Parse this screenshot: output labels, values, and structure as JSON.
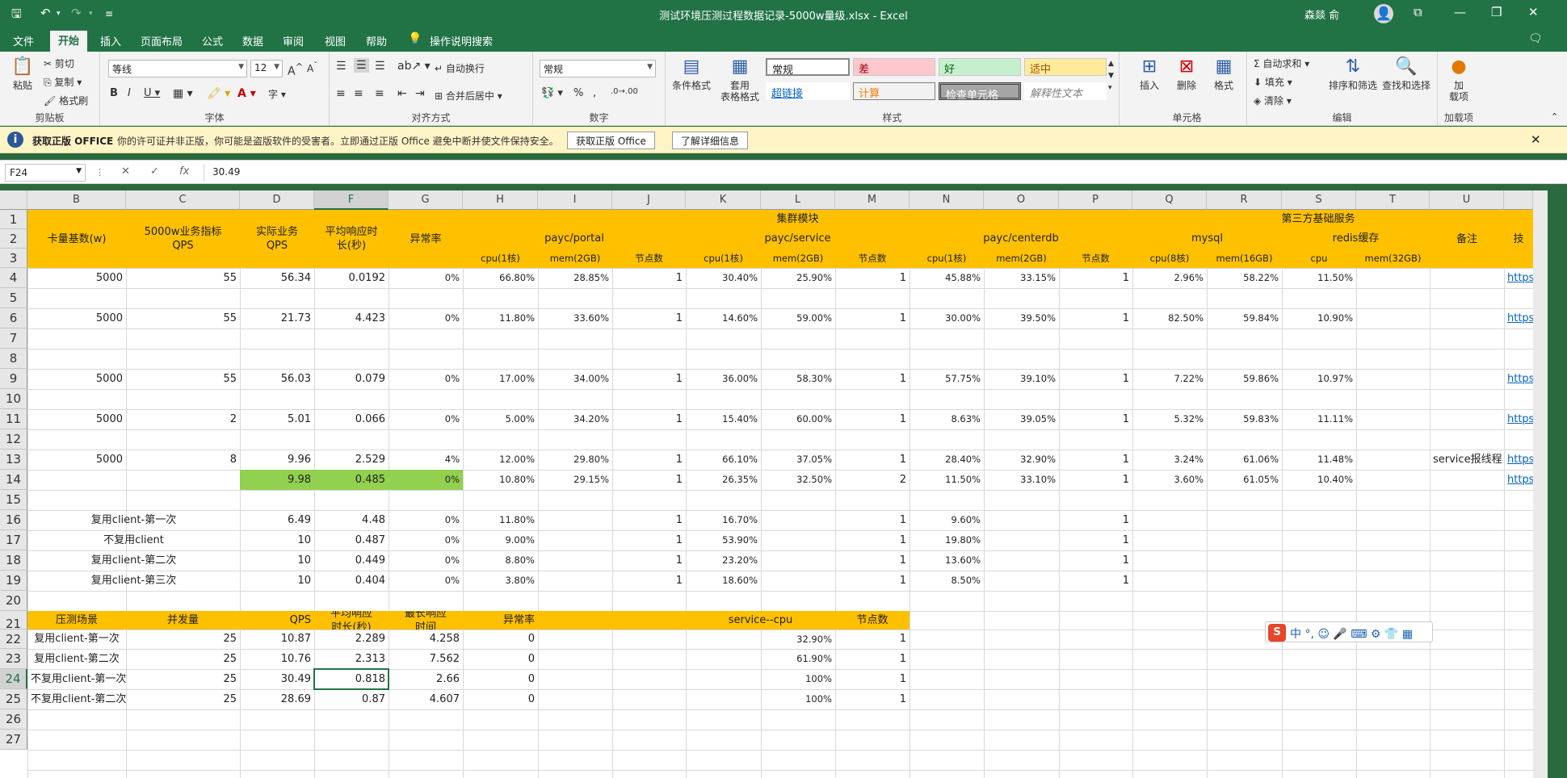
{
  "window": {
    "title": "测试环境压测过程数据记录-5000w量级.xlsx  -  Excel",
    "user": "森燚 俞"
  },
  "menu": [
    "文件",
    "开始",
    "插入",
    "页面布局",
    "公式",
    "数据",
    "审阅",
    "视图",
    "帮助",
    "操作说明搜索"
  ],
  "ribbon": {
    "clipboard": {
      "paste": "粘贴",
      "cut": "剪切",
      "copy": "复制",
      "format_painter": "格式刷",
      "label": "剪贴板"
    },
    "font": {
      "name": "等线",
      "size": "12",
      "label": "字体"
    },
    "alignment": {
      "wrap": "自动换行",
      "merge": "合并后居中",
      "label": "对齐方式"
    },
    "number": {
      "format": "常规",
      "label": "数字"
    },
    "styles": {
      "cond": "条件格式",
      "table": "套用\n表格格式",
      "s1": "常规",
      "s2": "差",
      "s3": "好",
      "s4": "适中",
      "s5": "超链接",
      "s6": "计算",
      "s7": "检查单元格",
      "s8": "解释性文本",
      "label": "样式"
    },
    "cells": {
      "insert": "插入",
      "delete": "删除",
      "format": "格式",
      "label": "单元格"
    },
    "editing": {
      "autosum": "自动求和",
      "fill": "填充",
      "clear": "清除",
      "sort": "排序和筛选",
      "find": "查找和选择",
      "label": "编辑"
    },
    "addins": {
      "add": "加\n载项",
      "label": "加载项"
    }
  },
  "message": {
    "bold": "获取正版 OFFICE",
    "text": "你的许可证并非正版，你可能是盗版软件的受害者。立即通过正版 Office 避免中断并使文件保持安全。",
    "btn1": "获取正版 Office",
    "btn2": "了解详细信息"
  },
  "formula_bar": {
    "name_box": "F24",
    "value": "30.49"
  },
  "columns": [
    "B",
    "C",
    "D",
    "F",
    "G",
    "H",
    "I",
    "J",
    "K",
    "L",
    "M",
    "N",
    "O",
    "P",
    "Q",
    "R",
    "S",
    "T",
    "U",
    ""
  ],
  "rows": [
    "1",
    "2",
    "3",
    "4",
    "5",
    "6",
    "7",
    "8",
    "9",
    "10",
    "11",
    "12",
    "13",
    "14",
    "15",
    "16",
    "17",
    "18",
    "19",
    "20",
    "21",
    "22",
    "23",
    "24",
    "25",
    "26",
    "27"
  ],
  "header": {
    "b": "卡量基数(w)",
    "c": "5000w业务指标\nQPS",
    "d": "实际业务\nQPS",
    "f": "平均响应时\n长(秒)",
    "g": "异常率",
    "cluster": "集群模块",
    "third": "第三方基础服务",
    "portal": "payc/portal",
    "service": "payc/service",
    "centerdb": "payc/centerdb",
    "mysql": "mysql",
    "redis": "redis缓存",
    "note": "备注",
    "v": "技",
    "cpu1": "cpu(1核)",
    "mem2": "mem(2GB)",
    "nodes": "节点数",
    "cpu8": "cpu(8核)",
    "mem16": "mem(16GB)",
    "cpu": "cpu",
    "mem32": "mem(32GB)"
  },
  "table1": [
    {
      "row": 4,
      "B": "5000",
      "C": "55",
      "D": "56.34",
      "F": "0.0192",
      "G": "0%",
      "H": "66.80%",
      "I": "28.85%",
      "J": "1",
      "K": "30.40%",
      "L": "25.90%",
      "M": "1",
      "N": "45.88%",
      "O": "33.15%",
      "P": "1",
      "Q": "2.96%",
      "R": "58.22%",
      "S": "11.50%",
      "U": "",
      "V": "https"
    },
    {
      "row": 6,
      "B": "5000",
      "C": "55",
      "D": "21.73",
      "F": "4.423",
      "G": "0%",
      "H": "11.80%",
      "I": "33.60%",
      "J": "1",
      "K": "14.60%",
      "L": "59.00%",
      "M": "1",
      "N": "30.00%",
      "O": "39.50%",
      "P": "1",
      "Q": "82.50%",
      "R": "59.84%",
      "S": "10.90%",
      "U": "",
      "V": "https"
    },
    {
      "row": 9,
      "B": "5000",
      "C": "55",
      "D": "56.03",
      "F": "0.079",
      "G": "0%",
      "H": "17.00%",
      "I": "34.00%",
      "J": "1",
      "K": "36.00%",
      "L": "58.30%",
      "M": "1",
      "N": "57.75%",
      "O": "39.10%",
      "P": "1",
      "Q": "7.22%",
      "R": "59.86%",
      "S": "10.97%",
      "U": "",
      "V": "https"
    },
    {
      "row": 11,
      "B": "5000",
      "C": "2",
      "D": "5.01",
      "F": "0.066",
      "G": "0%",
      "H": "5.00%",
      "I": "34.20%",
      "J": "1",
      "K": "15.40%",
      "L": "60.00%",
      "M": "1",
      "N": "8.63%",
      "O": "39.05%",
      "P": "1",
      "Q": "5.32%",
      "R": "59.83%",
      "S": "11.11%",
      "U": "",
      "V": "https"
    },
    {
      "row": 13,
      "B": "5000",
      "C": "8",
      "D": "9.96",
      "F": "2.529",
      "G": "4%",
      "H": "12.00%",
      "I": "29.80%",
      "J": "1",
      "K": "66.10%",
      "L": "37.05%",
      "M": "1",
      "N": "28.40%",
      "O": "32.90%",
      "P": "1",
      "Q": "3.24%",
      "R": "61.06%",
      "S": "11.48%",
      "U": "service报线程",
      "V": "https"
    },
    {
      "row": 14,
      "B": "",
      "C": "",
      "D": "9.98",
      "F": "0.485",
      "G": "0%",
      "H": "10.80%",
      "I": "29.15%",
      "J": "1",
      "K": "26.35%",
      "L": "32.50%",
      "M": "2",
      "N": "11.50%",
      "O": "33.10%",
      "P": "1",
      "Q": "3.60%",
      "R": "61.05%",
      "S": "10.40%",
      "U": "",
      "V": "https"
    }
  ],
  "table2": [
    {
      "row": 16,
      "B": "复用client-第一次",
      "D": "6.49",
      "F": "4.48",
      "G": "0%",
      "H": "11.80%",
      "J": "1",
      "K": "16.70%",
      "M": "1",
      "N": "9.60%",
      "P": "1"
    },
    {
      "row": 17,
      "B": "不复用client",
      "D": "10",
      "F": "0.487",
      "G": "0%",
      "H": "9.00%",
      "J": "1",
      "K": "53.90%",
      "M": "1",
      "N": "19.80%",
      "P": "1"
    },
    {
      "row": 18,
      "B": "复用client-第二次",
      "D": "10",
      "F": "0.449",
      "G": "0%",
      "H": "8.80%",
      "J": "1",
      "K": "23.20%",
      "M": "1",
      "N": "13.60%",
      "P": "1"
    },
    {
      "row": 19,
      "B": "复用client-第三次",
      "D": "10",
      "F": "0.404",
      "G": "0%",
      "H": "3.80%",
      "J": "1",
      "K": "18.60%",
      "M": "1",
      "N": "8.50%",
      "P": "1"
    }
  ],
  "table3_header": {
    "b": "压测场景",
    "c": "并发量",
    "d": "QPS",
    "f": "平均响应\n时长(秒)",
    "g": "最长响应\n时间",
    "h": "异常率",
    "kl": "service--cpu",
    "m": "节点数"
  },
  "table3": [
    {
      "row": 22,
      "B": "复用client-第一次",
      "C": "25",
      "D": "10.87",
      "F": "2.289",
      "G": "4.258",
      "H": "0",
      "L": "32.90%",
      "M": "1"
    },
    {
      "row": 23,
      "B": "复用client-第二次",
      "C": "25",
      "D": "10.76",
      "F": "2.313",
      "G": "7.562",
      "H": "0",
      "L": "61.90%",
      "M": "1"
    },
    {
      "row": 24,
      "B": "不复用client-第一次",
      "C": "25",
      "D": "30.49",
      "F": "0.818",
      "G": "2.66",
      "H": "0",
      "L": "100%",
      "M": "1"
    },
    {
      "row": 25,
      "B": "不复用client-第二次",
      "C": "25",
      "D": "28.69",
      "F": "0.87",
      "G": "4.607",
      "H": "0",
      "L": "100%",
      "M": "1"
    }
  ],
  "ime": {
    "text": "中 °, ☺ 🎤 ⌨ ⚙ 👕 ▦"
  }
}
